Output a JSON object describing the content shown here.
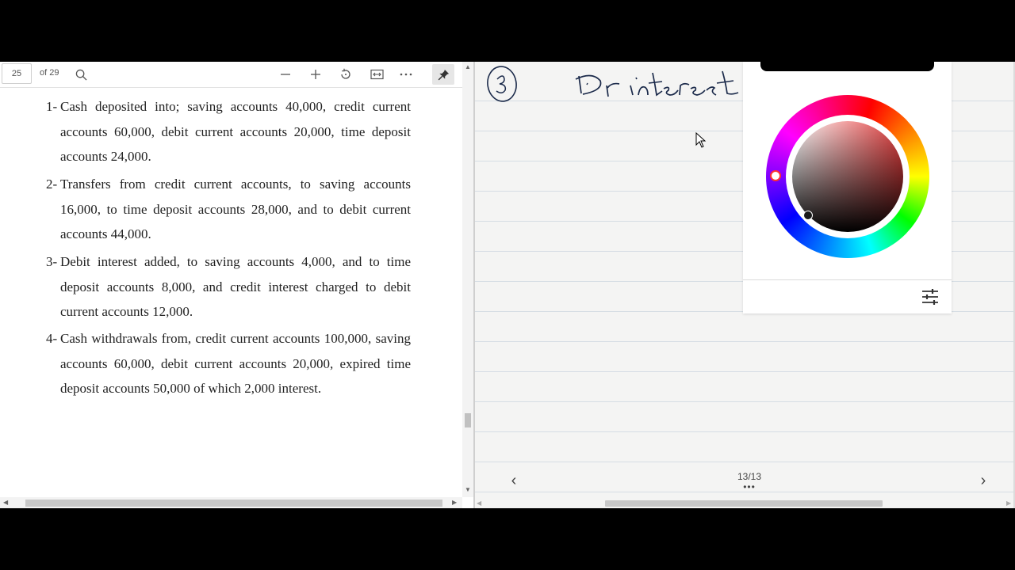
{
  "pdf": {
    "toolbar": {
      "page_number": "25",
      "page_total": "of 29",
      "icons": {
        "search": "search-icon",
        "zoom_out": "minus-icon",
        "zoom_in": "plus-icon",
        "rotate": "rotate-icon",
        "fit": "fit-width-icon",
        "more": "more-icon",
        "pin": "pin-icon"
      }
    },
    "questions": [
      {
        "num": "1-",
        "text": "Cash deposited into; saving accounts 40,000, credit current accounts 60,000, debit current accounts 20,000, time deposit accounts 24,000."
      },
      {
        "num": "2-",
        "text": "Transfers from credit current accounts, to saving accounts 16,000, to time deposit accounts 28,000, and to debit current accounts 44,000."
      },
      {
        "num": "3-",
        "text": "Debit interest added, to saving accounts 4,000, and to time deposit accounts 8,000, and credit interest charged to debit current accounts 12,000."
      },
      {
        "num": "4-",
        "text": "Cash withdrawals from, credit current accounts 100,000, saving accounts 60,000, debit current accounts 20,000, expired time deposit accounts 50,000 of which 2,000 interest."
      }
    ]
  },
  "notebook": {
    "page_indicator": "13/13",
    "more_label": "•••",
    "prev_label": "‹",
    "next_label": "›",
    "handwriting": "Dr interest",
    "handwriting_circled": "3",
    "colors": {
      "paper": "#f4f4f3",
      "rule_line": "#d6dde4",
      "ink": "#1b2a4a"
    }
  },
  "color_picker": {
    "selected_hue_color": "#ff0000",
    "selected_color": "#1a1a1a",
    "settings_icon": "adjust-sliders-icon"
  }
}
